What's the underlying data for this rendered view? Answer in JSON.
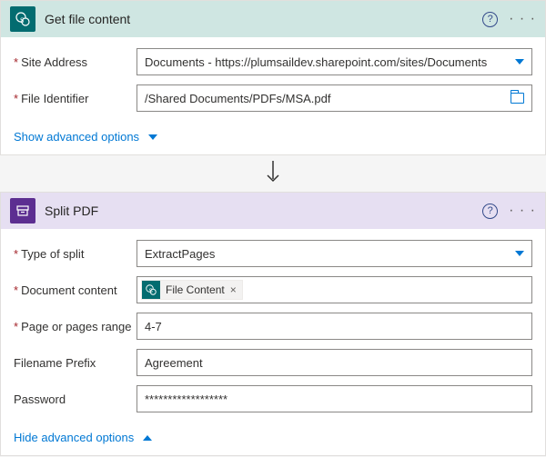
{
  "action1": {
    "title": "Get file content",
    "fields": {
      "siteAddress": {
        "label": "Site Address",
        "value": "Documents - https://plumsaildev.sharepoint.com/sites/Documents"
      },
      "fileIdentifier": {
        "label": "File Identifier",
        "value": "/Shared Documents/PDFs/MSA.pdf"
      }
    },
    "advLink": "Show advanced options"
  },
  "action2": {
    "title": "Split PDF",
    "fields": {
      "typeOfSplit": {
        "label": "Type of split",
        "value": "ExtractPages"
      },
      "documentContent": {
        "label": "Document content",
        "tokenLabel": "File Content"
      },
      "pageRange": {
        "label": "Page or pages range",
        "value": "4-7"
      },
      "filenamePrefix": {
        "label": "Filename Prefix",
        "value": "Agreement"
      },
      "password": {
        "label": "Password",
        "value": "******************"
      }
    },
    "advLink": "Hide advanced options"
  },
  "icons": {
    "help": "?",
    "tokenX": "×",
    "ellipsis": "· · ·"
  }
}
